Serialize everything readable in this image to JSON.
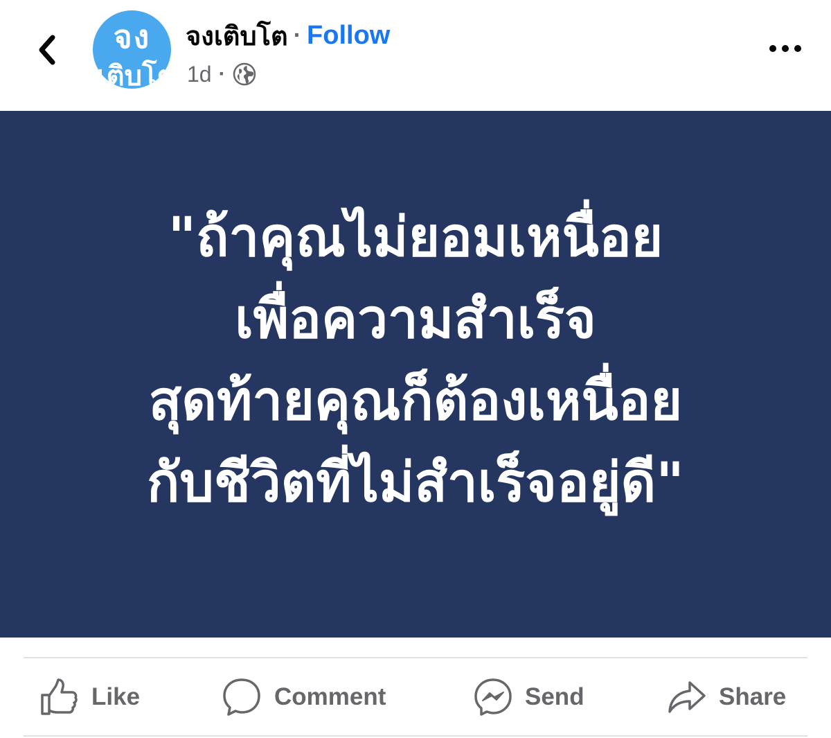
{
  "header": {
    "back_icon": "chevron-left-icon",
    "avatar": {
      "line1": "จง",
      "line2": "เติบโต",
      "color": "#4aa8ee"
    },
    "page_name": "จงเติบโต",
    "separator": "·",
    "follow_label": "Follow",
    "post_time": "1d",
    "meta_separator": "·",
    "privacy_icon": "globe-icon",
    "more_icon": "more-horizontal-icon"
  },
  "post": {
    "background_color": "#253661",
    "quote_lines": [
      "\"ถ้าคุณไม่ยอมเหนื่อย",
      "เพื่อความสำเร็จ",
      "สุดท้ายคุณก็ต้องเหนื่อย",
      "กับชีวิตที่ไม่สำเร็จอยู่ดี\""
    ]
  },
  "actions": [
    {
      "label": "Like",
      "icon": "thumbs-up-icon"
    },
    {
      "label": "Comment",
      "icon": "comment-bubble-icon"
    },
    {
      "label": "Send",
      "icon": "messenger-icon"
    },
    {
      "label": "Share",
      "icon": "share-arrow-icon"
    }
  ],
  "colors": {
    "link": "#1877f2",
    "secondary_text": "#65676b",
    "primary_text": "#050505"
  }
}
